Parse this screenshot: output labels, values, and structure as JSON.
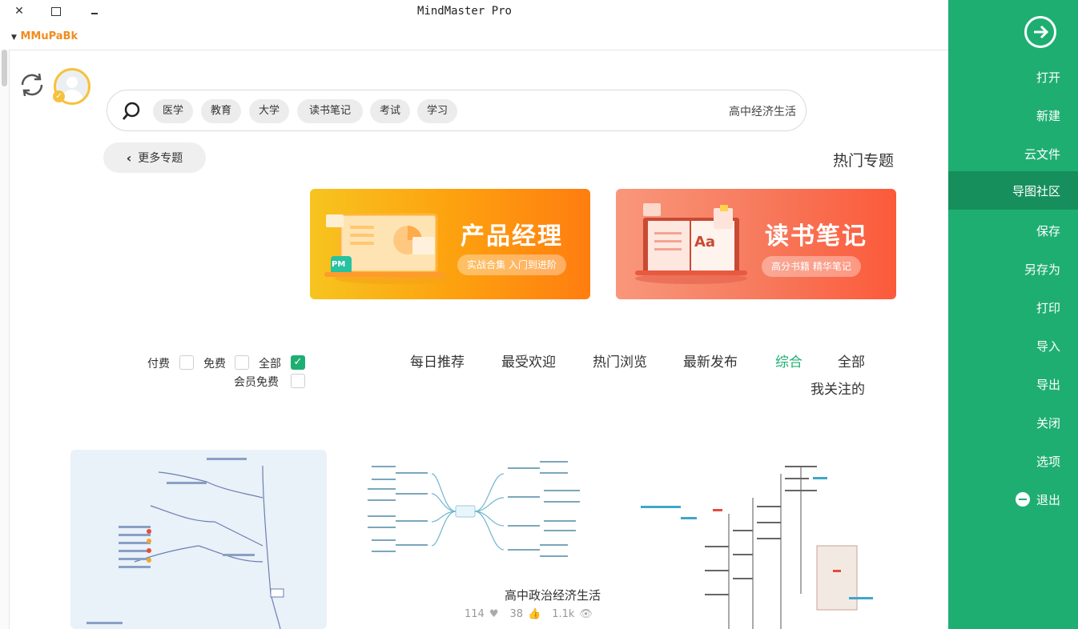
{
  "window": {
    "title": "MindMaster Pro",
    "user": "MMuPaBk"
  },
  "sidebar": {
    "items": [
      {
        "label": "打开"
      },
      {
        "label": "新建"
      },
      {
        "label": "云文件"
      },
      {
        "label": "导图社区",
        "active": true
      },
      {
        "label": "保存"
      },
      {
        "label": "另存为"
      },
      {
        "label": "打印"
      },
      {
        "label": "导入"
      },
      {
        "label": "导出"
      },
      {
        "label": "关闭"
      },
      {
        "label": "选项"
      },
      {
        "label": "退出"
      }
    ]
  },
  "search": {
    "value": "高中经济生活",
    "tags": [
      "学习",
      "考试",
      "读书笔记",
      "大学",
      "教育",
      "医学"
    ]
  },
  "hot_topics": {
    "title": "热门专题",
    "more_label": "更多专题"
  },
  "banners": [
    {
      "title": "读书笔记",
      "subtitle": "高分书籍 精华笔记",
      "icon_text": "Aa"
    },
    {
      "title": "产品经理",
      "subtitle": "实战合集 入门到进阶",
      "icon_text": "PM"
    }
  ],
  "filters": {
    "tabs": [
      "全部",
      "综合",
      "最新发布",
      "热门浏览",
      "最受欢迎",
      "每日推荐",
      "我关注的"
    ],
    "active_tab": "综合",
    "price_options": [
      {
        "label": "全部",
        "checked": true
      },
      {
        "label": "免费",
        "checked": false
      },
      {
        "label": "付费",
        "checked": false
      },
      {
        "label": "会员免费",
        "checked": false
      }
    ]
  },
  "cards": [
    {
      "title": "高中政治经济生活",
      "views": "1.1k",
      "likes": "38",
      "favorites": "114"
    }
  ],
  "colors": {
    "accent": "#1fae72",
    "accent_dark": "#168f5d",
    "user": "#f08c1e"
  }
}
